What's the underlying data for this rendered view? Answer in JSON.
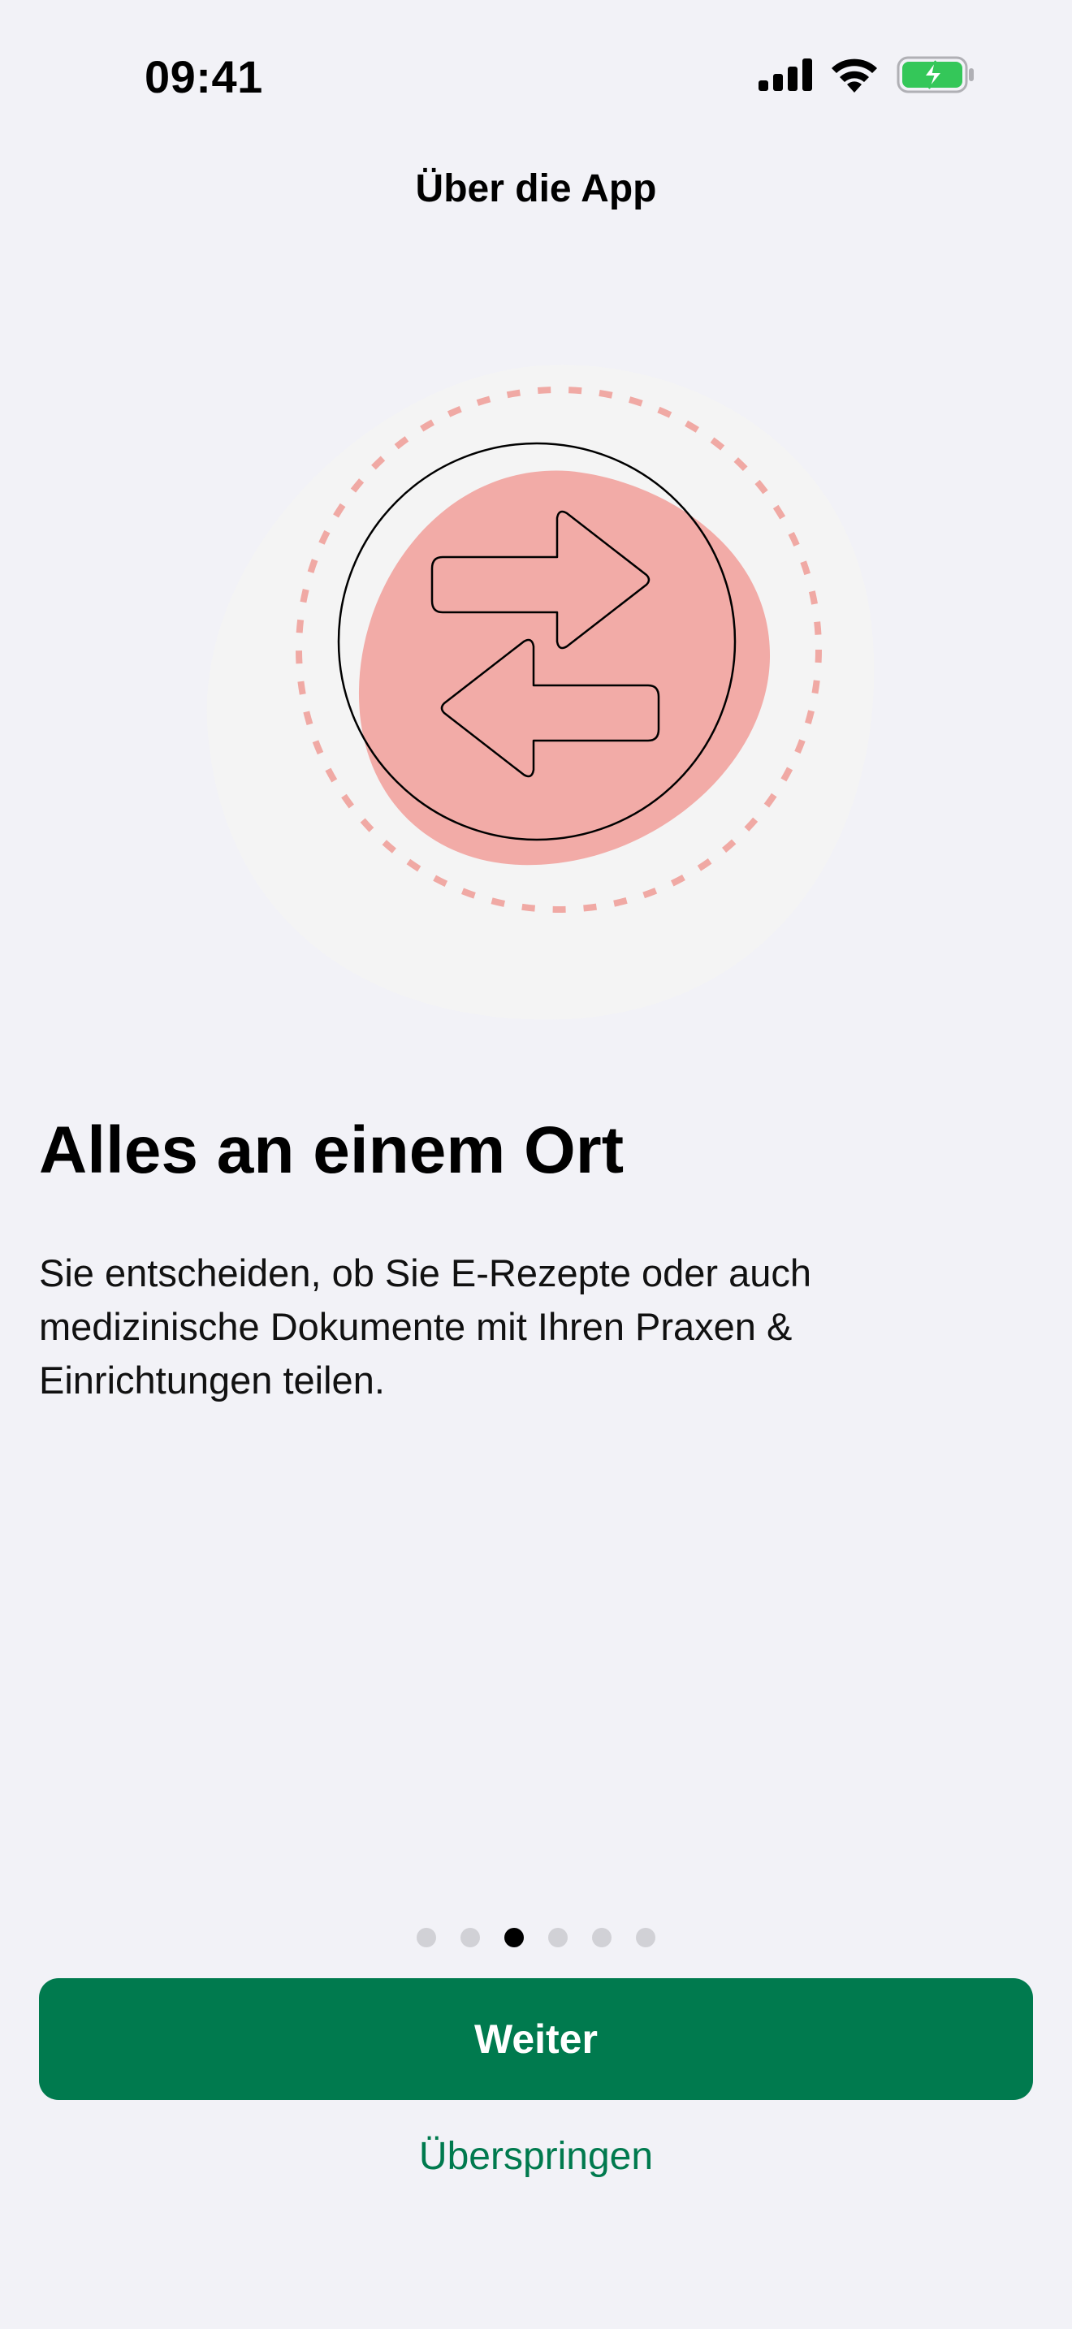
{
  "status_bar": {
    "time": "09:41",
    "icons": [
      "cellular-signal-icon",
      "wifi-icon",
      "battery-charging-icon"
    ],
    "battery_color": "#34c759"
  },
  "nav": {
    "title": "Über die App"
  },
  "illustration": {
    "icon": "swap-arrows-icon",
    "blob_color": "#f2aba7",
    "ring_color": "#f0a9a4",
    "backdrop_color": "#f4f4f4"
  },
  "content": {
    "headline": "Alles an einem Ort",
    "body": "Sie entscheiden, ob Sie E-Rezepte oder auch medizinische Dokumente mit Ihren Praxen & Einrichtungen teilen."
  },
  "pager": {
    "total": 6,
    "current": 3
  },
  "actions": {
    "next_label": "Weiter",
    "skip_label": "Überspringen",
    "accent_color": "#007a4e"
  }
}
